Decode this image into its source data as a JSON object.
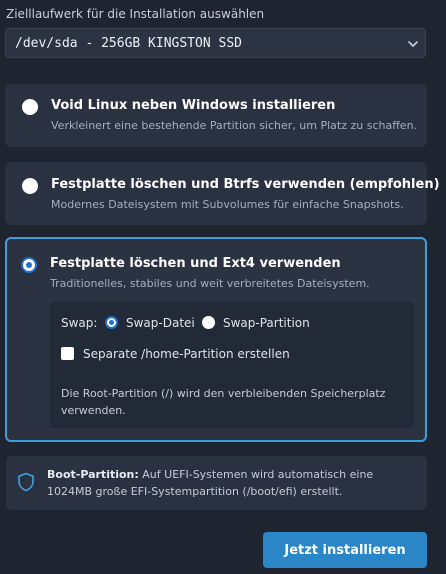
{
  "target": {
    "label": "Zielllaufwerk für die Installation auswählen",
    "selected_disk": "/dev/sda - 256GB KINGSTON SSD",
    "chevron_icon": "chevron-down-icon"
  },
  "options": [
    {
      "title": "Void Linux neben Windows installieren",
      "description": "Verkleinert eine bestehende Partition sicher, um Platz zu schaffen.",
      "selected": false
    },
    {
      "title": "Festplatte löschen und Btrfs verwenden (empfohlen)",
      "description": "Modernes Dateisystem mit Subvolumes für einfache Snapshots.",
      "selected": false
    },
    {
      "title": "Festplatte löschen und Ext4 verwenden",
      "description": "Traditionelles, stabiles und weit verbreitetes Dateisystem.",
      "selected": true
    }
  ],
  "ext4_settings": {
    "swap_label": "Swap:",
    "swap_options": [
      {
        "label": "Swap-Datei",
        "selected": true
      },
      {
        "label": "Swap-Partition",
        "selected": false
      }
    ],
    "home_partition_label": "Separate /home-Partition erstellen",
    "home_partition_checked": false,
    "root_note": "Die Root-Partition (/) wird den verbleibenden Speicherplatz verwenden."
  },
  "info": {
    "icon": "shield-icon",
    "title": "Boot-Partition:",
    "text": "Auf UEFI-Systemen wird automatisch eine 1024MB große EFI-Systempartition (/boot/efi) erstellt."
  },
  "install_button": "Jetzt installieren",
  "colors": {
    "background": "#1f2431",
    "card": "#2a3140",
    "accent": "#3b9fdb",
    "button": "#2b86c8"
  }
}
